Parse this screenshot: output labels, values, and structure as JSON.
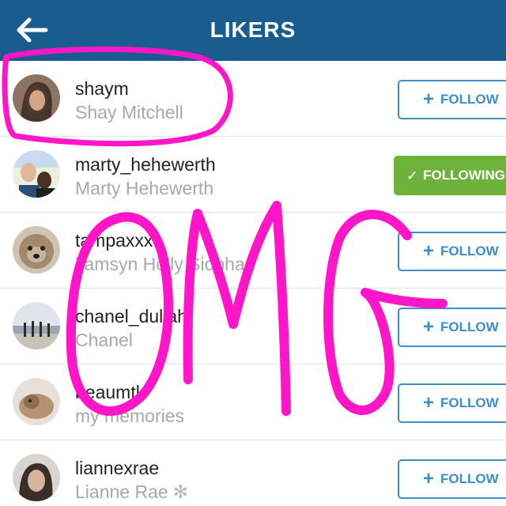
{
  "header": {
    "title": "LIKERS",
    "back_icon": "arrow-left-icon",
    "background": "#1b5c8f"
  },
  "colors": {
    "follow": "#3d8dcc",
    "following": "#6cb23b",
    "annotation": "#ff16c8"
  },
  "likers": [
    {
      "username": "shaym",
      "full_name": "Shay Mitchell",
      "button": {
        "state": "follow",
        "label": "FOLLOW",
        "icon": "plus-icon"
      }
    },
    {
      "username": "marty_hehewerth",
      "full_name": "Marty Hehewerth",
      "button": {
        "state": "following",
        "label": "FOLLOWING",
        "icon": "check-icon"
      }
    },
    {
      "username": "tampaxxx",
      "full_name": "Tamsyn Holly Siobhan",
      "button": {
        "state": "follow",
        "label": "FOLLOW",
        "icon": "plus-icon"
      }
    },
    {
      "username": "chanel_dullah",
      "full_name": "Chanel",
      "button": {
        "state": "follow",
        "label": "FOLLOW",
        "icon": "plus-icon"
      }
    },
    {
      "username": "beaumtk",
      "full_name": "my memories",
      "button": {
        "state": "follow",
        "label": "FOLLOW",
        "icon": "plus-icon"
      }
    },
    {
      "username": "liannexrae",
      "full_name": "Lianne Rae",
      "full_name_suffix": "✻",
      "button": {
        "state": "follow",
        "label": "FOLLOW",
        "icon": "plus-icon"
      }
    }
  ],
  "annotation": {
    "text": "OMG",
    "circled_item": "shaym"
  }
}
